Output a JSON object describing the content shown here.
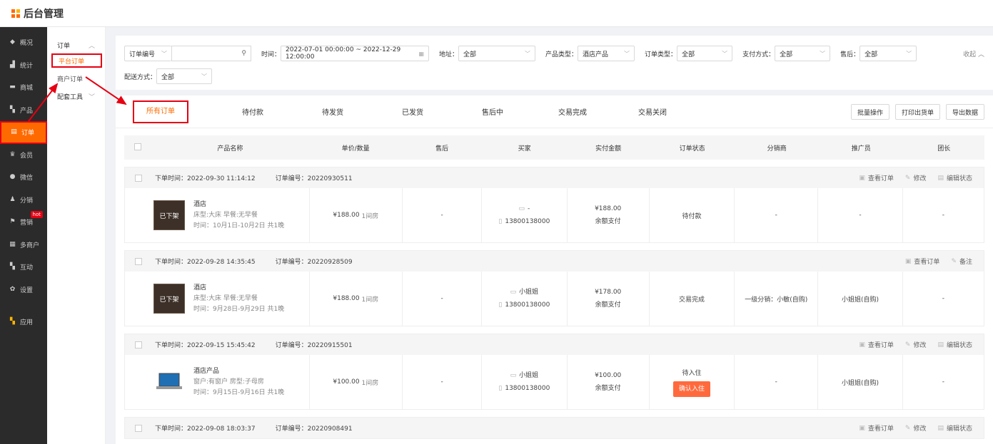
{
  "app": {
    "title": "后台管理"
  },
  "sidebar": {
    "items": [
      {
        "label": "概况",
        "icon": "gauge-icon"
      },
      {
        "label": "统计",
        "icon": "chart-icon"
      },
      {
        "label": "商城",
        "icon": "shop-icon"
      },
      {
        "label": "产品",
        "icon": "grid-icon"
      },
      {
        "label": "订单",
        "icon": "order-icon",
        "active": true
      },
      {
        "label": "会员",
        "icon": "crown-icon"
      },
      {
        "label": "微信",
        "icon": "wechat-icon"
      },
      {
        "label": "分销",
        "icon": "user-icon"
      },
      {
        "label": "营销",
        "icon": "flag-icon",
        "badge": "hot"
      },
      {
        "label": "多商户",
        "icon": "store-icon"
      },
      {
        "label": "互动",
        "icon": "grid-icon"
      },
      {
        "label": "设置",
        "icon": "gear-icon"
      },
      {
        "label": "应用",
        "icon": "apps-icon"
      }
    ]
  },
  "subnav": {
    "group": "订单",
    "items": [
      "平台订单",
      "商户订单"
    ],
    "group2": "配套工具"
  },
  "filters": {
    "order_no_label": "订单编号",
    "time_label": "时间：",
    "time_range": "2022-07-01 00:00:00 ~ 2022-12-29 12:00:00",
    "address_label": "地址：",
    "address_value": "全部",
    "product_type_label": "产品类型：",
    "product_type_value": "酒店产品",
    "order_type_label": "订单类型：",
    "order_type_value": "全部",
    "pay_label": "支付方式：",
    "pay_value": "全部",
    "aftersale_label": "售后：",
    "aftersale_value": "全部",
    "delivery_label": "配送方式：",
    "delivery_value": "全部",
    "collapse": "收起"
  },
  "tabs": [
    "所有订单",
    "待付款",
    "待发货",
    "已发货",
    "售后中",
    "交易完成",
    "交易关闭"
  ],
  "actions": [
    "批量操作",
    "打印出货单",
    "导出数据"
  ],
  "columns": [
    "产品名称",
    "单价/数量",
    "售后",
    "买家",
    "实付金额",
    "订单状态",
    "分销商",
    "推广员",
    "团长"
  ],
  "orders": [
    {
      "time": "下单时间：2022-09-30 11:14:12",
      "no": "订单编号：20220930511",
      "links": [
        "查看订单",
        "修改",
        "编辑状态"
      ],
      "thumb": "已下架",
      "name": "酒店",
      "spec": "床型:大床 早餐:无早餐",
      "date": "时间：10月1日-10月2日 共1晚",
      "price": "¥188.00",
      "qty": "1间房",
      "after": "-",
      "buyer": "-",
      "phone": "13800138000",
      "paid": "¥188.00",
      "paymethod": "余额支付",
      "status": "待付款",
      "dist": "-",
      "promoter": "-",
      "leader": "-"
    },
    {
      "time": "下单时间：2022-09-28 14:35:45",
      "no": "订单编号：20220928509",
      "links": [
        "查看订单",
        "备注"
      ],
      "thumb": "已下架",
      "name": "酒店",
      "spec": "床型:大床 早餐:无早餐",
      "date": "时间：9月28日-9月29日 共1晚",
      "price": "¥188.00",
      "qty": "1间房",
      "after": "-",
      "buyer": "小姐姐",
      "phone": "13800138000",
      "paid": "¥178.00",
      "paymethod": "余额支付",
      "status": "交易完成",
      "dist": "一级分销：小敏(自购)",
      "promoter": "小姐姐(自购)",
      "leader": "-"
    },
    {
      "time": "下单时间：2022-09-15 15:45:42",
      "no": "订单编号：20220915501",
      "links": [
        "查看订单",
        "修改",
        "编辑状态"
      ],
      "thumb": "",
      "name": "酒店产品",
      "spec": "窗户:有窗户 房型:子母房",
      "date": "时间：9月15日-9月16日 共1晚",
      "price": "¥100.00",
      "qty": "1间房",
      "after": "-",
      "buyer": "小姐姐",
      "phone": "13800138000",
      "paid": "¥100.00",
      "paymethod": "余额支付",
      "status": "待入住",
      "confirm": "确认入住",
      "dist": "-",
      "promoter": "小姐姐(自购)",
      "leader": "-"
    },
    {
      "time": "下单时间：2022-09-08 18:03:37",
      "no": "订单编号：20220908491",
      "links": [
        "查看订单",
        "修改",
        "编辑状态"
      ]
    }
  ]
}
